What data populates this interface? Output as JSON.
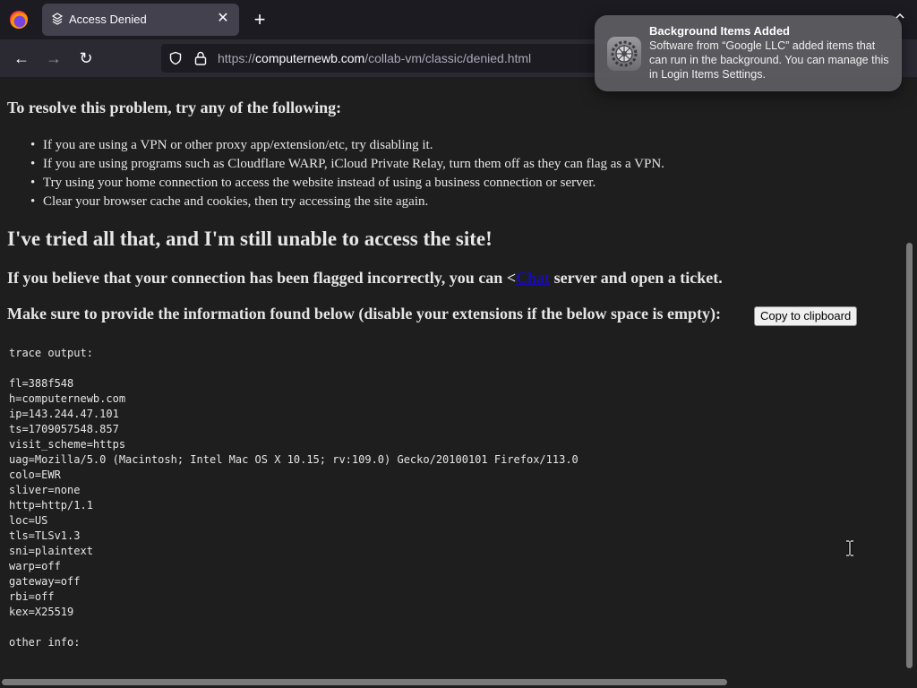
{
  "browser": {
    "tab_title": "Access Denied",
    "tab_close": "✕",
    "new_tab": "+",
    "back": "←",
    "forward": "→",
    "reload": "↻",
    "url_prefix": "https://",
    "url_host": "computernewb.com",
    "url_path": "/collab-vm/classic/denied.html"
  },
  "page": {
    "resolve_heading": "To resolve this problem, try any of the following:",
    "fixes": [
      "If you are using a VPN or other proxy app/extension/etc, try disabling it.",
      "If you are using programs such as Cloudflare WARP, iCloud Private Relay, turn them off as they can flag as a VPN.",
      "Try using your home connection to access the website instead of using a business connection or server.",
      "Clear your browser cache and cookies, then try accessing the site again."
    ],
    "tried_heading": "I've tried all that, and I'm still unable to access the site!",
    "flagged_before": "If you believe that your connection has been flagged incorrectly, you can <",
    "flagged_link": "Chat",
    "flagged_after": " server and open a ticket.",
    "provide_text": "Make sure to provide the information found below (disable your extensions if the below space is empty):",
    "copy_button": "Copy to clipboard",
    "trace_output": "trace output:\n\nfl=388f548\nh=computernewb.com\nip=143.244.47.101\nts=1709057548.857\nvisit_scheme=https\nuag=Mozilla/5.0 (Macintosh; Intel Mac OS X 10.15; rv:109.0) Gecko/20100101 Firefox/113.0\ncolo=EWR\nsliver=none\nhttp=http/1.1\nloc=US\ntls=TLSv1.3\nsni=plaintext\nwarp=off\ngateway=off\nrbi=off\nkex=X25519\n\nother info:"
  },
  "notification": {
    "title": "Background Items Added",
    "body": "Software from “Google LLC” added items that can run in the background. You can manage this in Login Items Settings.",
    "icon": "system-settings-gear-icon"
  },
  "colors": {
    "link": "#1a0dab",
    "page_bg": "#1e1e1e",
    "chrome_bg": "#2b2a33"
  }
}
